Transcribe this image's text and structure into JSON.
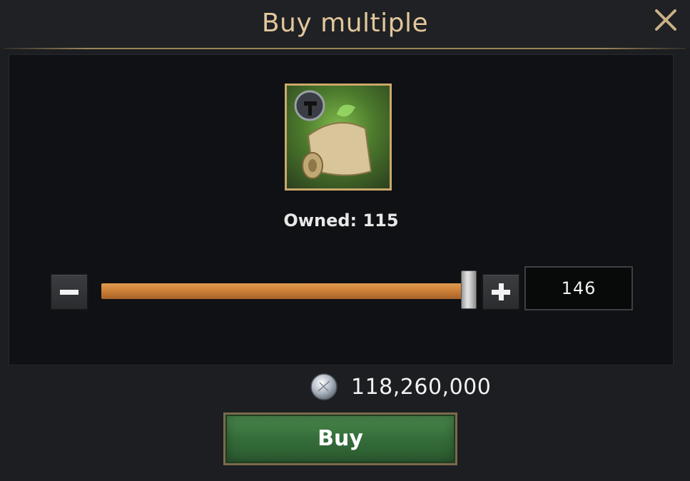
{
  "dialog": {
    "title": "Buy multiple",
    "close_icon": "close-x-icon"
  },
  "item": {
    "icon": "helmet-scroll-icon",
    "owned_label": "Owned: 115"
  },
  "quantity": {
    "value": "146",
    "slider_fraction": 1.0,
    "decrease_icon": "minus-icon",
    "increase_icon": "plus-icon"
  },
  "cost": {
    "currency_icon": "silver-coin-icon",
    "amount": "118,260,000"
  },
  "actions": {
    "buy_label": "Buy"
  },
  "colors": {
    "title": "#e2c79b",
    "slider_fill": "#c97c35",
    "buy_button": "#356d3a",
    "item_border": "#caa96a"
  }
}
